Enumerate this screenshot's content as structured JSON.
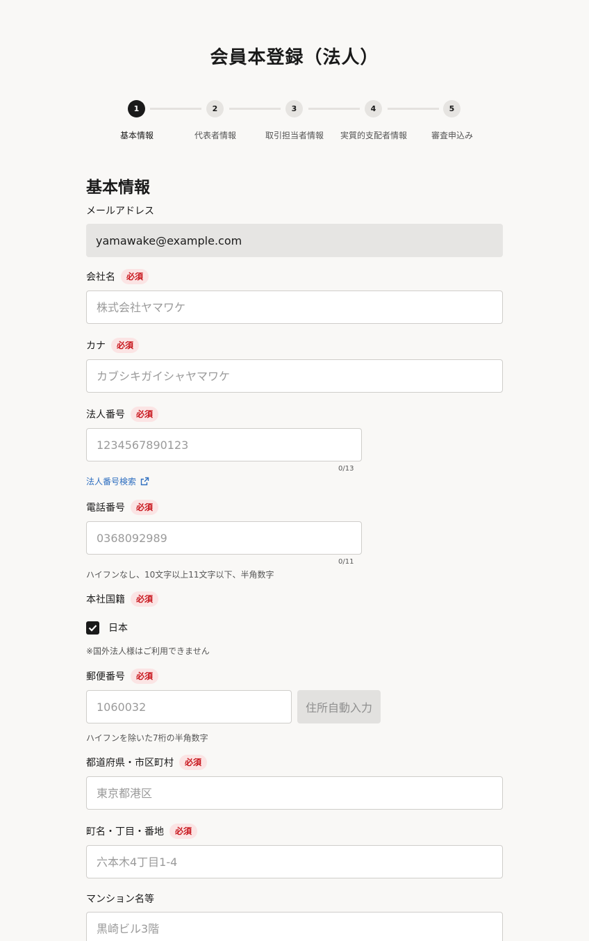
{
  "page": {
    "title": "会員本登録（法人）"
  },
  "stepper": {
    "steps": [
      {
        "number": "1",
        "label": "基本情報",
        "active": true
      },
      {
        "number": "2",
        "label": "代表者情報",
        "active": false
      },
      {
        "number": "3",
        "label": "取引担当者情報",
        "active": false
      },
      {
        "number": "4",
        "label": "実質的支配者情報",
        "active": false
      },
      {
        "number": "5",
        "label": "審査申込み",
        "active": false
      }
    ]
  },
  "section": {
    "title": "基本情報"
  },
  "required_label": "必須",
  "form": {
    "email": {
      "label": "メールアドレス",
      "value": "yamawake@example.com"
    },
    "company_name": {
      "label": "会社名",
      "placeholder": "株式会社ヤマワケ"
    },
    "kana": {
      "label": "カナ",
      "placeholder": "カブシキガイシャヤマワケ"
    },
    "corporate_number": {
      "label": "法人番号",
      "placeholder": "1234567890123",
      "counter": "0/13",
      "search_link": "法人番号検索"
    },
    "phone": {
      "label": "電話番号",
      "placeholder": "0368092989",
      "counter": "0/11",
      "hint": "ハイフンなし、10文字以上11文字以下、半角数字"
    },
    "nationality": {
      "label": "本社国籍",
      "option": "日本",
      "checked": true,
      "note": "※国外法人様はご利用できません"
    },
    "postal_code": {
      "label": "郵便番号",
      "placeholder": "1060032",
      "button": "住所自動入力",
      "hint": "ハイフンを除いた7桁の半角数字"
    },
    "prefecture_city": {
      "label": "都道府県・市区町村",
      "placeholder": "東京都港区"
    },
    "town_address": {
      "label": "町名・丁目・番地",
      "placeholder": "六本木4丁目1-4"
    },
    "building": {
      "label": "マンション名等",
      "placeholder": "黒崎ビル3階"
    }
  },
  "colors": {
    "accent": "#1a1a1a",
    "required": "#c8161d",
    "link": "#2f6fc0",
    "background": "#f9f8f6"
  },
  "icons": {
    "external_link": "external-link-icon",
    "check": "check-icon"
  }
}
